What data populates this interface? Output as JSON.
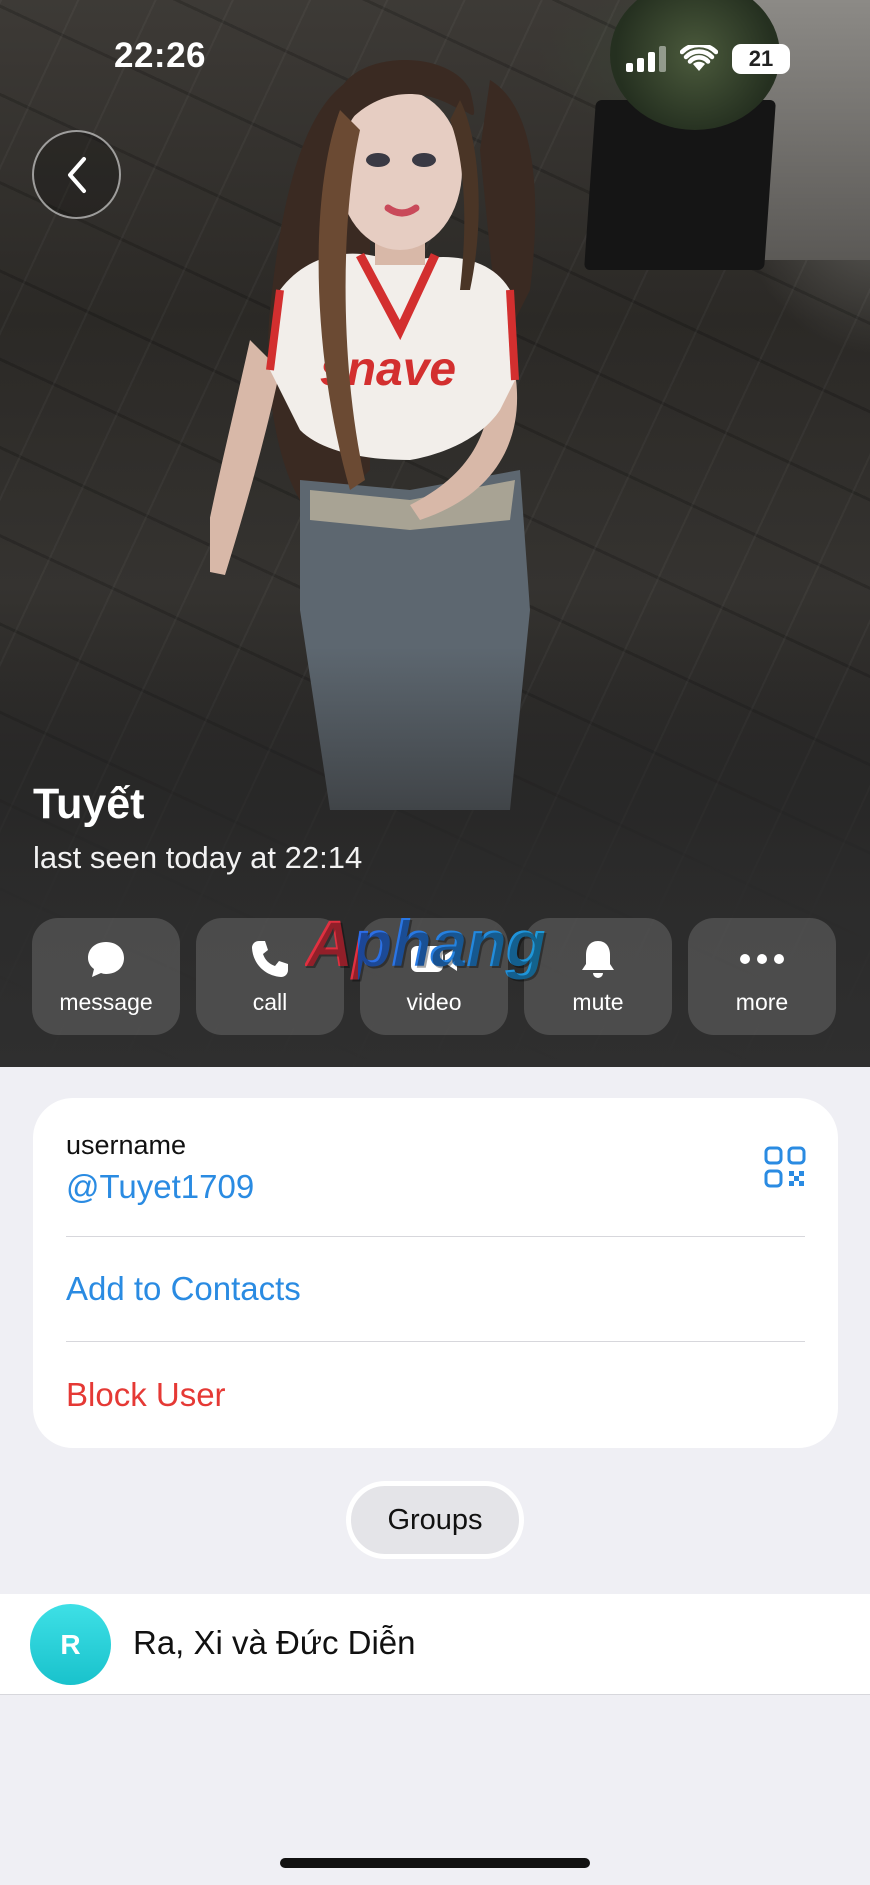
{
  "status_bar": {
    "time": "22:26",
    "battery": "21"
  },
  "profile": {
    "name": "Tuyết",
    "last_seen": "last seen today at 22:14"
  },
  "actions": [
    {
      "label": "message",
      "icon": "chat-bubble-icon"
    },
    {
      "label": "call",
      "icon": "phone-icon"
    },
    {
      "label": "video",
      "icon": "video-camera-icon"
    },
    {
      "label": "mute",
      "icon": "bell-icon"
    },
    {
      "label": "more",
      "icon": "more-dots-icon"
    }
  ],
  "watermark": "Aphang",
  "info": {
    "username_label": "username",
    "username_value": "@Tuyet1709",
    "add_contacts": "Add to Contacts",
    "block_user": "Block User"
  },
  "tabs": {
    "groups": "Groups"
  },
  "groups": [
    {
      "avatar_letter": "R",
      "name": "Ra, Xi và Đức Diễn"
    }
  ],
  "colors": {
    "accent_blue": "#2a8be2",
    "danger_red": "#e53935",
    "background": "#efeff4",
    "avatar_cyan": "#19c2cc"
  }
}
